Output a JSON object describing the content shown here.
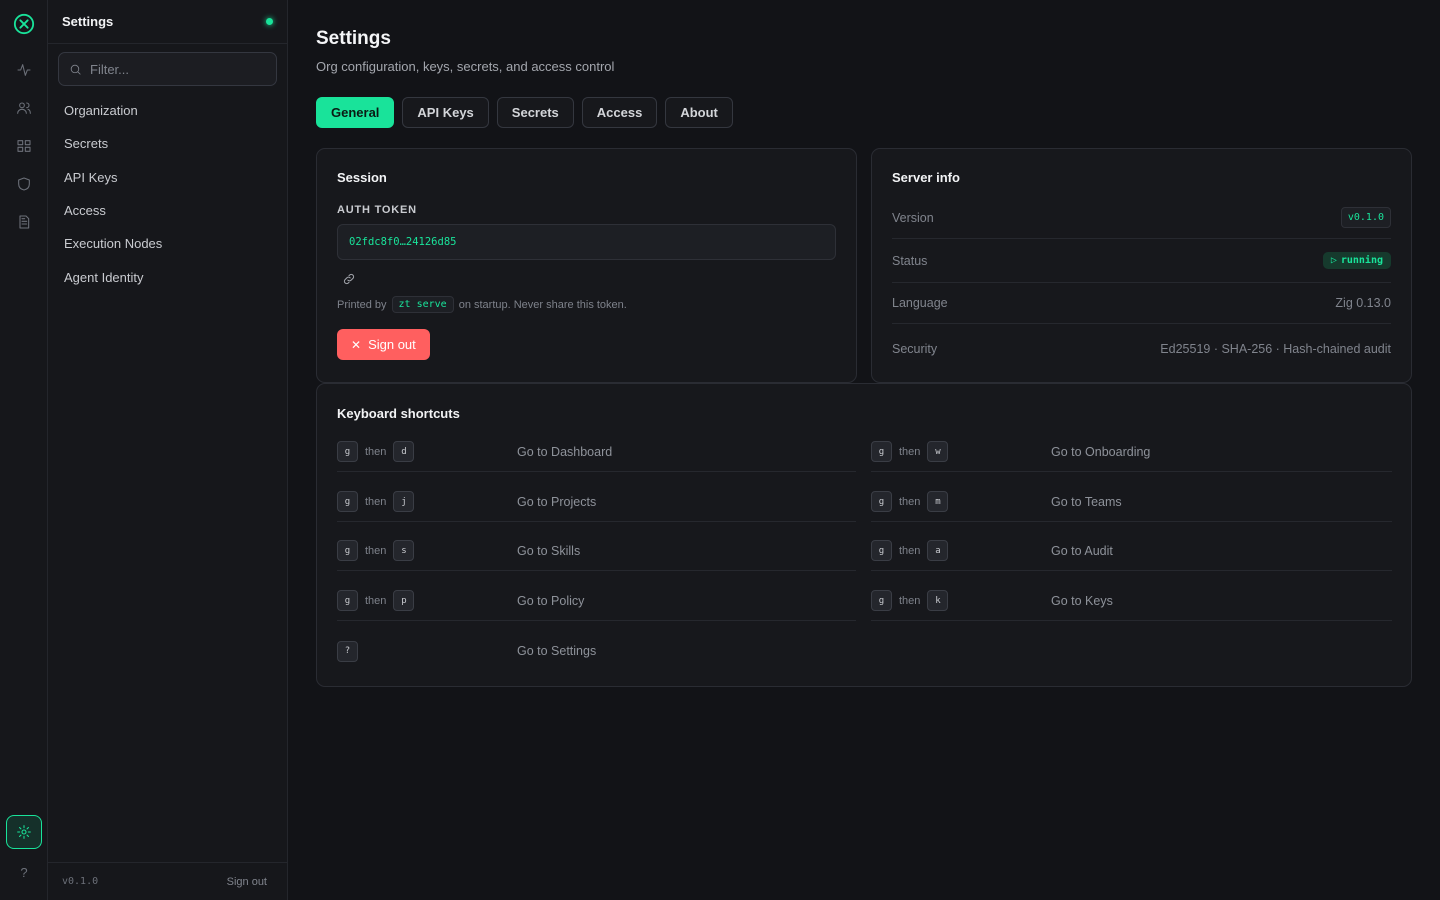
{
  "rail": {
    "icons": [
      "logo-icon",
      "activity-icon",
      "users-icon",
      "grid-icon",
      "shield-icon",
      "document-icon",
      "gear-icon"
    ],
    "help": "?"
  },
  "sidebar": {
    "title": "Settings",
    "filter_placeholder": "Filter...",
    "items": [
      {
        "label": "Organization"
      },
      {
        "label": "Secrets"
      },
      {
        "label": "API Keys"
      },
      {
        "label": "Access"
      },
      {
        "label": "Execution Nodes"
      },
      {
        "label": "Agent Identity"
      }
    ],
    "footer": {
      "version": "v0.1.0",
      "sign_out": "Sign out"
    }
  },
  "main": {
    "title": "Settings",
    "subtitle": "Org configuration, keys, secrets, and access control",
    "tabs": [
      {
        "label": "General",
        "active": true
      },
      {
        "label": "API Keys"
      },
      {
        "label": "Secrets"
      },
      {
        "label": "Access"
      },
      {
        "label": "About"
      }
    ]
  },
  "session": {
    "title": "Session",
    "token_label": "AUTH TOKEN",
    "token_value": "02fdc8f0…24126d85",
    "hint_prefix": "Printed by",
    "hint_code": "zt serve",
    "hint_suffix": "on startup. Never share this token.",
    "sign_out": "Sign out"
  },
  "server_info": {
    "title": "Server info",
    "rows": [
      {
        "key": "Version",
        "value": "v0.1.0"
      },
      {
        "key": "Status",
        "value": "running"
      },
      {
        "key": "Language",
        "value": "Zig 0.13.0"
      },
      {
        "key": "Security",
        "value": "Ed25519 · SHA-256 · Hash-chained audit"
      }
    ]
  },
  "shortcuts": {
    "title": "Keyboard shortcuts",
    "then": "then",
    "items": [
      {
        "k1": "g",
        "k2": "d",
        "label": "Go to Dashboard"
      },
      {
        "k1": "g",
        "k2": "w",
        "label": "Go to Onboarding"
      },
      {
        "k1": "g",
        "k2": "j",
        "label": "Go to Projects"
      },
      {
        "k1": "g",
        "k2": "m",
        "label": "Go to Teams"
      },
      {
        "k1": "g",
        "k2": "s",
        "label": "Go to Skills"
      },
      {
        "k1": "g",
        "k2": "a",
        "label": "Go to Audit"
      },
      {
        "k1": "g",
        "k2": "p",
        "label": "Go to Policy"
      },
      {
        "k1": "g",
        "k2": "k",
        "label": "Go to Keys"
      },
      {
        "k1": "?",
        "label": "Go to Settings"
      }
    ]
  },
  "colors": {
    "accent": "#19e39a",
    "danger": "#ff5f5f",
    "background": "#121317"
  }
}
